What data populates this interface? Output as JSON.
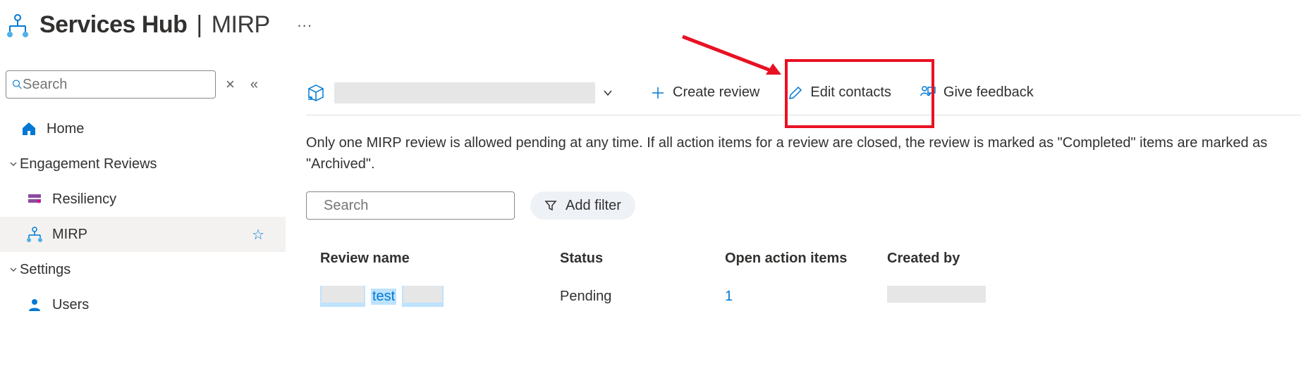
{
  "header": {
    "title_main": "Services Hub",
    "title_sep": "|",
    "title_sub": "MIRP",
    "more_label": "···"
  },
  "sidebar": {
    "search_placeholder": "Search",
    "clear_label": "×",
    "collapse_label": "«",
    "items": [
      {
        "label": "Home"
      },
      {
        "label": "Engagement Reviews"
      },
      {
        "label": "Resiliency"
      },
      {
        "label": "MIRP"
      },
      {
        "label": "Settings"
      },
      {
        "label": "Users"
      }
    ],
    "fav_glyph": "☆"
  },
  "toolbar": {
    "dropdown_chevron": "⌄",
    "create_review": "Create review",
    "edit_contacts": "Edit contacts",
    "give_feedback": "Give feedback"
  },
  "description": "Only one MIRP review is allowed pending at any time. If all action items for a review are closed, the review is marked as \"Completed\" items are marked as \"Archived\".",
  "content": {
    "search_placeholder": "Search",
    "add_filter": "Add filter"
  },
  "table": {
    "headers": {
      "name": "Review name",
      "status": "Status",
      "open": "Open action items",
      "created": "Created by"
    },
    "rows": [
      {
        "name_mid": "test",
        "status": "Pending",
        "open": "1"
      }
    ]
  }
}
